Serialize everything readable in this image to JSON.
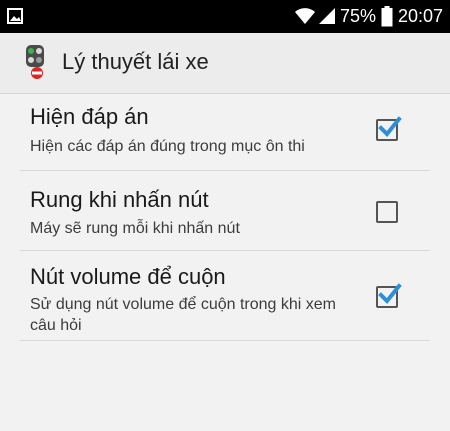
{
  "status_bar": {
    "battery_text": "75%",
    "time": "20:07",
    "icons": [
      "gallery-icon",
      "wifi-icon",
      "signal-icon",
      "battery-icon"
    ]
  },
  "app": {
    "title": "Lý thuyết lái xe",
    "icon": "traffic-light-icon"
  },
  "settings": [
    {
      "title": "Hiện đáp án",
      "summary": "Hiện các đáp án đúng trong mục ôn thi",
      "checked": true
    },
    {
      "title": "Rung khi nhấn nút",
      "summary": "Máy sẽ rung mỗi khi nhấn nút",
      "checked": false
    },
    {
      "title": "Nút volume để cuộn",
      "summary": "Sử dụng nút volume để cuộn trong khi xem câu hỏi",
      "checked": true
    }
  ],
  "colors": {
    "check_accent": "#2f8fd6",
    "background": "#f2f2f2",
    "status_bar": "#000000"
  }
}
